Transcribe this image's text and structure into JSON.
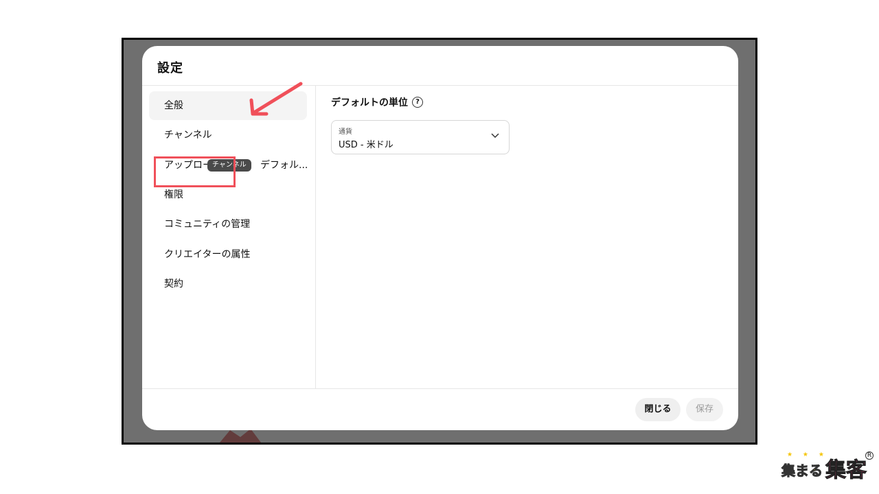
{
  "modal": {
    "title": "設定"
  },
  "sidebar": {
    "items": [
      {
        "label": "全般",
        "active": true
      },
      {
        "label": "チャンネル"
      },
      {
        "label": "アップロー　　　　　デフォル..."
      },
      {
        "label": "権限"
      },
      {
        "label": "コミュニティの管理"
      },
      {
        "label": "クリエイターの属性"
      },
      {
        "label": "契約"
      }
    ],
    "tooltip": "チャンネル"
  },
  "content": {
    "field_label": "デフォルトの単位",
    "help_icon": "?",
    "currency_select": {
      "caption": "通貨",
      "value": "USD - 米ドル"
    }
  },
  "footer": {
    "close_label": "閉じる",
    "save_label": "保存"
  },
  "annotation": {
    "highlight_color": "#f0505a",
    "arrow_color": "#f0505a"
  },
  "watermark": {
    "stars": "★ ★ ★",
    "text_small": "集まる",
    "text_large": "集客",
    "reg": "R"
  }
}
